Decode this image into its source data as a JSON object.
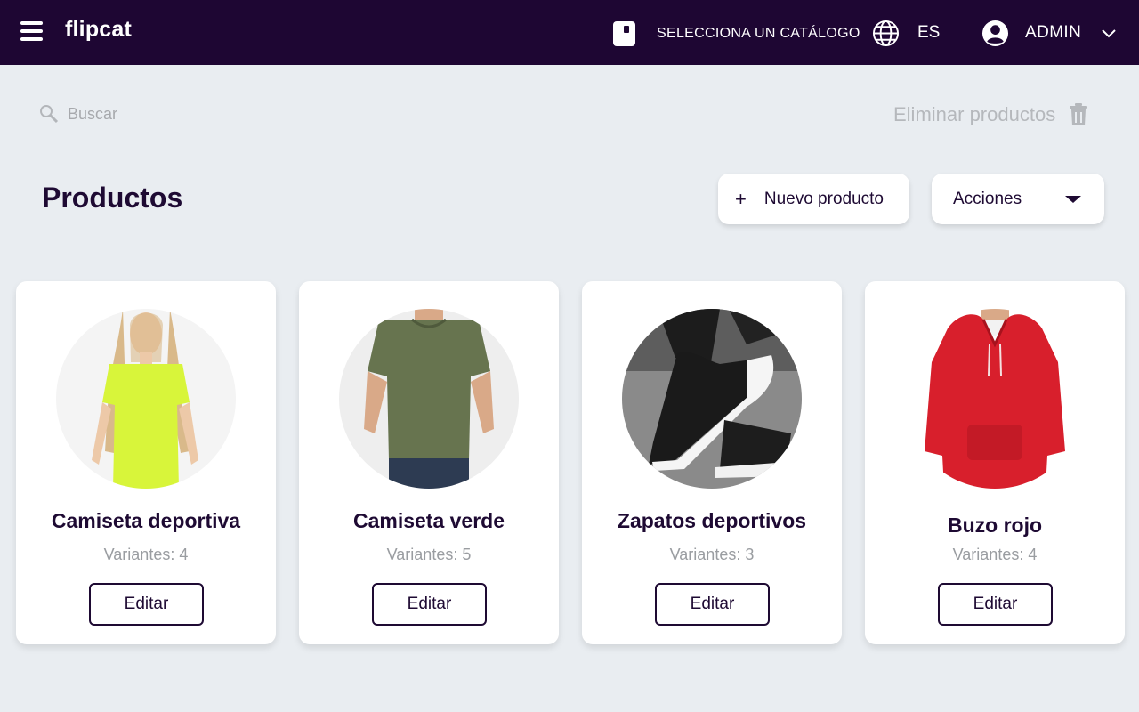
{
  "header": {
    "logo": "flipcat",
    "catalog_label": "SELECCIONA UN CATÁLOGO",
    "language": "ES",
    "user": "ADMIN"
  },
  "toolbar": {
    "search_placeholder": "Buscar",
    "delete_label": "Eliminar productos"
  },
  "main": {
    "title": "Productos",
    "new_product_icon": "+",
    "new_product_label": "Nuevo producto",
    "actions_label": "Acciones"
  },
  "products": [
    {
      "name": "Camiseta deportiva",
      "variants_label": "Variantes:",
      "variants": "4",
      "edit_label": "Editar"
    },
    {
      "name": "Camiseta verde",
      "variants_label": "Variantes:",
      "variants": "5",
      "edit_label": "Editar"
    },
    {
      "name": "Zapatos deportivos",
      "variants_label": "Variantes:",
      "variants": "3",
      "edit_label": "Editar"
    },
    {
      "name": "Buzo rojo",
      "variants_label": "Variantes:",
      "variants": "4",
      "edit_label": "Editar"
    }
  ],
  "colors": {
    "topbar": "#1e0633",
    "background": "#e9edf1",
    "text_dark": "#1e0a33",
    "muted": "#9a9da1"
  },
  "icons": [
    "menu-icon",
    "catalog-icon",
    "globe-icon",
    "user-avatar-icon",
    "chevron-down-icon",
    "search-icon",
    "trash-icon",
    "plus-icon",
    "caret-down-icon"
  ]
}
